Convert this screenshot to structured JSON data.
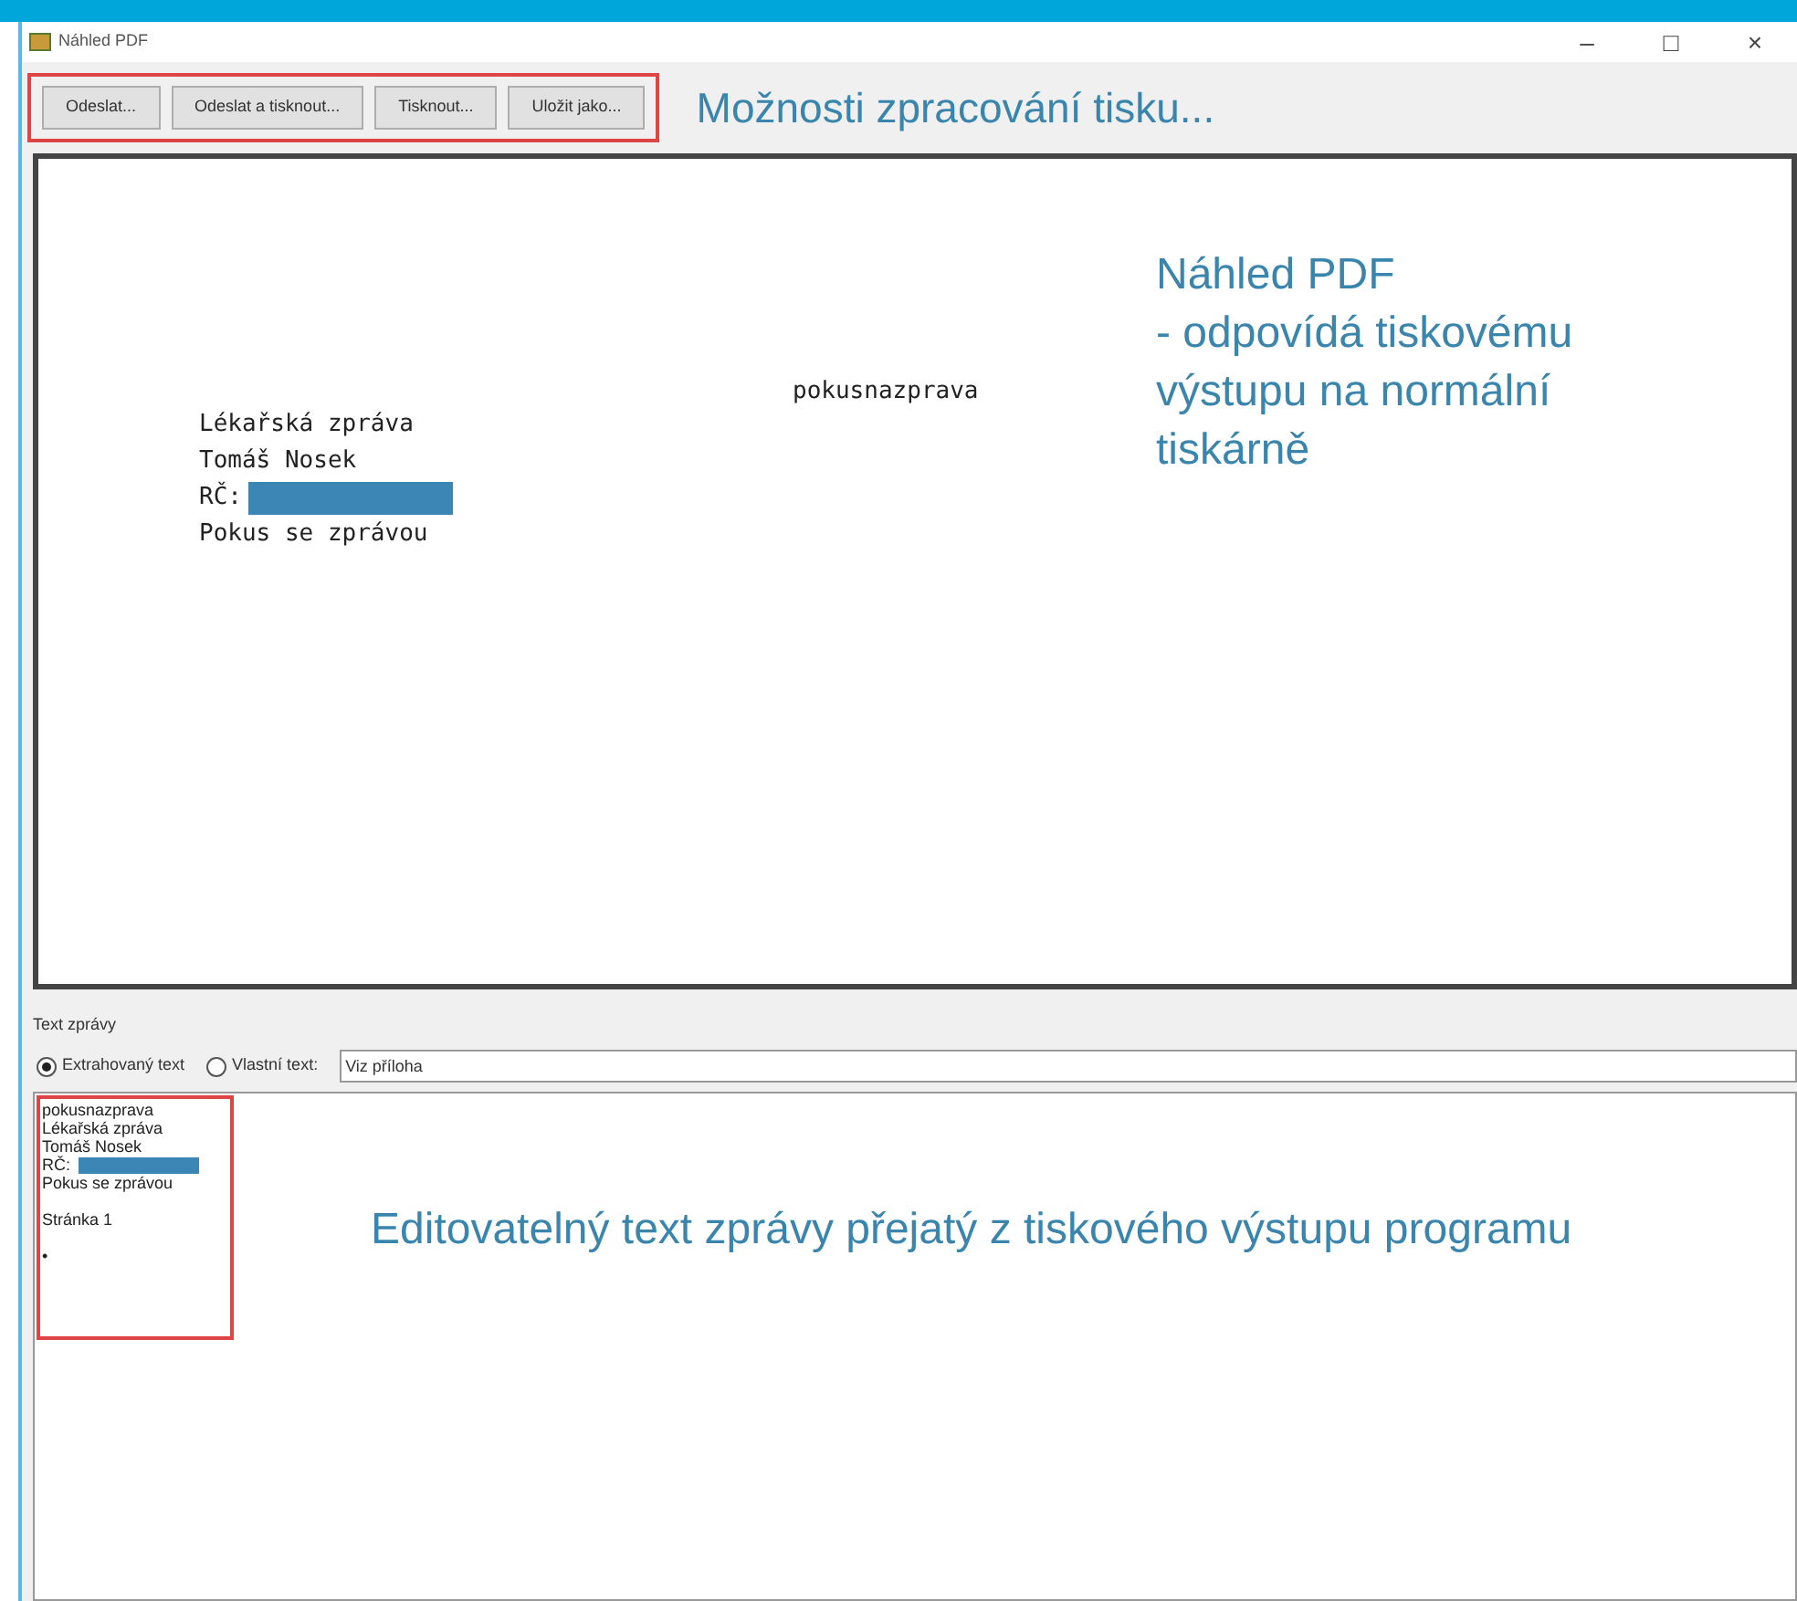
{
  "window": {
    "title": "Náhled PDF",
    "controls": [
      "–",
      "□",
      "×"
    ]
  },
  "toolbar": {
    "buttons": [
      "Odeslat...",
      "Odeslat a tisknout...",
      "Tisknout...",
      "Uložit jako..."
    ],
    "annotation": "Možnosti zpracování tisku..."
  },
  "preview": {
    "header": "pokusnazprava",
    "lines": [
      {
        "kind": "text",
        "text": "Lékařská zpráva"
      },
      {
        "kind": "text",
        "text": "Tomáš Nosek"
      },
      {
        "kind": "redacted",
        "text": "RČ:"
      },
      {
        "kind": "text",
        "text": "Pokus se zprávou"
      }
    ],
    "annotation": [
      "Náhled PDF",
      "- odpovídá tiskovému",
      "výstupu na normální",
      "tiskárně"
    ]
  },
  "message": {
    "label": "Text zprávy",
    "options": [
      {
        "label": "Extrahovaný text",
        "selected": true
      },
      {
        "label": "Vlastní text:",
        "selected": false
      }
    ],
    "custom_text": "Viz příloha",
    "lines": [
      {
        "kind": "text",
        "text": "pokusnazprava"
      },
      {
        "kind": "text",
        "text": "Lékařská zpráva"
      },
      {
        "kind": "text",
        "text": "Tomáš Nosek"
      },
      {
        "kind": "redacted",
        "text": "RČ:"
      },
      {
        "kind": "text",
        "text": "Pokus se zprávou"
      },
      {
        "kind": "blank"
      },
      {
        "kind": "text",
        "text": "Stránka 1"
      },
      {
        "kind": "blank"
      },
      {
        "kind": "text",
        "text": "•"
      }
    ],
    "annotation": "Editovatelný text zprávy přejatý z tiskového výstupu programu"
  }
}
